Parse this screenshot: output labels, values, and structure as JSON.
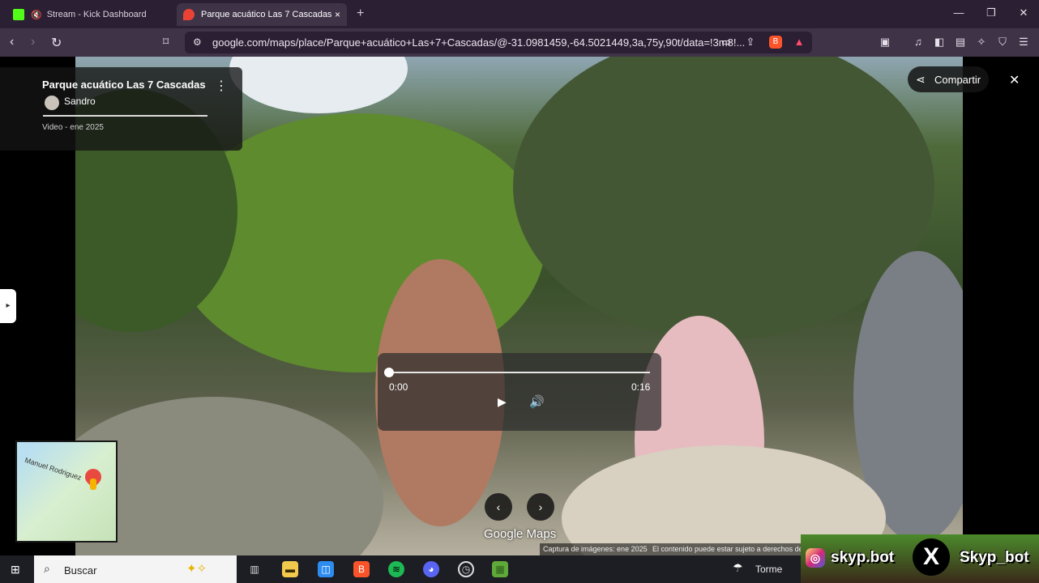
{
  "browser": {
    "tabs": [
      {
        "title": "Stream - Kick Dashboard",
        "close": "×"
      },
      {
        "title": "Parque acuático Las 7 Cascadas",
        "close": "×"
      }
    ],
    "new_tab": "+",
    "url": "google.com/maps/place/Parque+acuático+Las+7+Cascadas/@-31.0981459,-64.5021449,3a,75y,90t/data=!3m8!...",
    "accent_color": "#3f3347"
  },
  "maps": {
    "place_title": "Parque acuático Las 7 Cascadas",
    "author": "Sandro",
    "media_info": "Video - ene 2025",
    "share_label": "Compartir",
    "player": {
      "current_time": "0:00",
      "duration": "0:16",
      "progress": 0
    },
    "minimap": {
      "road_label": "Manuel Rodriguez"
    },
    "logo": "Google Maps",
    "capture_text": "Captura de imágenes: ene 2025",
    "content_text": "El contenido puede estar sujeto a derechos de"
  },
  "taskbar": {
    "search_placeholder": "Buscar",
    "weather_text": "Torme"
  },
  "overlay": {
    "instagram_handle": "skyp.bot",
    "x_handle": "Skyp_bot"
  },
  "icons": [
    "kick-icon",
    "mute-icon",
    "maps-pin-icon",
    "back-icon",
    "forward-icon",
    "reload-icon",
    "bookmark-icon",
    "site-info-icon",
    "cast-icon",
    "share-icon",
    "brave-shield-icon",
    "brave-rewards-icon",
    "reader-icon",
    "music-icon",
    "sidebar-icon",
    "wallet-icon",
    "leo-icon",
    "vpn-icon",
    "menu-icon",
    "kebab-icon",
    "share-nodes-icon",
    "close-icon",
    "play-icon",
    "volume-icon",
    "chevron-left-icon",
    "chevron-right-icon",
    "windows-icon",
    "search-icon",
    "sparkle-icon",
    "task-view-icon",
    "file-explorer-icon",
    "store-icon",
    "brave-icon",
    "spotify-icon",
    "discord-icon",
    "clock-icon",
    "minecraft-icon",
    "umbrella-icon",
    "instagram-icon",
    "x-icon"
  ]
}
